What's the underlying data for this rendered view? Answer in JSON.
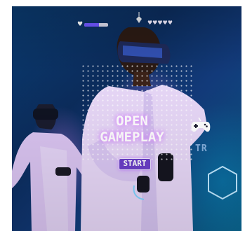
{
  "hud": {
    "health_fraction": 0.62,
    "health_icon": "heart-icon",
    "lives_text": "♥♥♥♥♥",
    "gem_icon": "crystal-icon"
  },
  "main": {
    "title_line1": "OPEN",
    "title_line2": "GAMEPLAY",
    "start_label": "START",
    "controller_icon": "gamepad-icon"
  },
  "background": {
    "sign_text": "TR",
    "hex_icon": "hexagon-icon"
  },
  "colors": {
    "accent": "#6a3fc8",
    "health_fill": "#6f56ff",
    "glow": "#b95cff"
  }
}
